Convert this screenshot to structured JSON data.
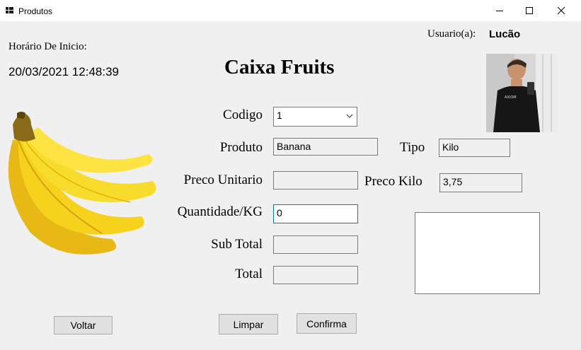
{
  "window": {
    "title": "Produtos",
    "controls": {
      "minimize": "minimize",
      "maximize": "maximize",
      "close": "close"
    }
  },
  "header": {
    "user_label": "Usuario(a):",
    "user_name": "Lucão",
    "start_label": "Horário De Inicio:",
    "start_value": "20/03/2021 12:48:39",
    "app_title": "Caixa Fruits"
  },
  "form": {
    "codigo": {
      "label": "Codigo",
      "value": "1"
    },
    "produto": {
      "label": "Produto",
      "value": "Banana"
    },
    "tipo": {
      "label": "Tipo",
      "value": "Kilo"
    },
    "preco_unitario": {
      "label": "Preco Unitario",
      "value": ""
    },
    "preco_kilo": {
      "label": "Preco Kilo",
      "value": "3,75"
    },
    "quantidade": {
      "label": "Quantidade/KG",
      "value": "0"
    },
    "sub_total": {
      "label": "Sub Total",
      "value": ""
    },
    "total": {
      "label": "Total",
      "value": ""
    }
  },
  "buttons": {
    "voltar": "Voltar",
    "limpar": "Limpar",
    "confirma": "Confirma"
  },
  "colors": {
    "window_bg": "#f0f0f0",
    "titlebar_bg": "#ffffff",
    "focus_border": "#0078d7",
    "banana_yellow": "#f6d21c"
  },
  "icons": {
    "app": "grid-icon",
    "product_image": "banana-image",
    "user_photo": "user-photo"
  }
}
